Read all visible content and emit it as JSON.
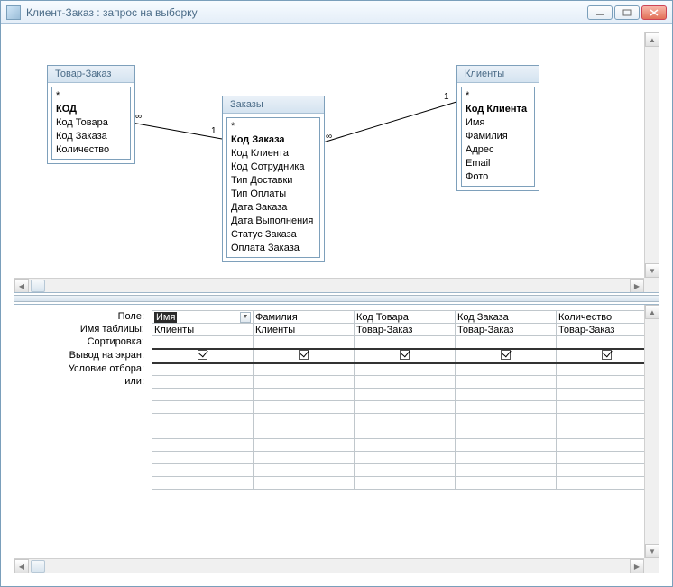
{
  "window": {
    "title": "Клиент-Заказ : запрос на выборку"
  },
  "tables": {
    "t1": {
      "title": "Товар-Заказ",
      "fields": [
        "*",
        "КОД",
        "Код Товара",
        "Код Заказа",
        "Количество"
      ],
      "pk_index": 1
    },
    "t2": {
      "title": "Заказы",
      "fields": [
        "*",
        "Код Заказа",
        "Код Клиента",
        "Код Сотрудника",
        "Тип Доставки",
        "Тип Оплаты",
        "Дата Заказа",
        "Дата Выполнения",
        "Статус Заказа",
        "Оплата Заказа"
      ],
      "pk_index": 1
    },
    "t3": {
      "title": "Клиенты",
      "fields": [
        "*",
        "Код Клиента",
        "Имя",
        "Фамилия",
        "Адрес",
        "Email",
        "Фото"
      ],
      "pk_index": 1
    }
  },
  "relations": {
    "r1": {
      "left": "∞",
      "right": "1"
    },
    "r2": {
      "left": "∞",
      "right": "1"
    }
  },
  "grid": {
    "row_labels": {
      "field": "Поле:",
      "table": "Имя таблицы:",
      "sort": "Сортировка:",
      "show": "Вывод на экран:",
      "criteria": "Условие отбора:",
      "or": "или:"
    },
    "columns": [
      {
        "field": "Имя",
        "table": "Клиенты",
        "show": true
      },
      {
        "field": "Фамилия",
        "table": "Клиенты",
        "show": true
      },
      {
        "field": "Код Товара",
        "table": "Товар-Заказ",
        "show": true
      },
      {
        "field": "Код Заказа",
        "table": "Товар-Заказ",
        "show": true
      },
      {
        "field": "Количество",
        "table": "Товар-Заказ",
        "show": true
      }
    ]
  }
}
